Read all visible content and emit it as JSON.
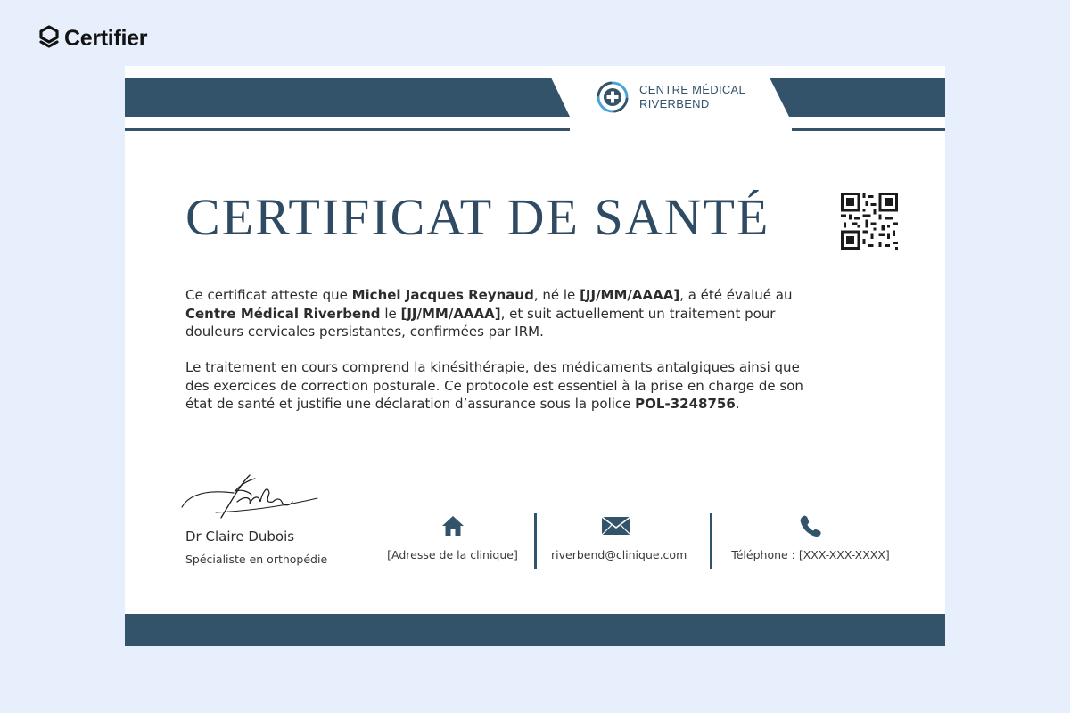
{
  "brand": {
    "name": "Certifier",
    "icon": "certifier-logo-icon"
  },
  "clinic": {
    "name_line1": "CENTRE MÉDICAL",
    "name_line2": "RIVERBEND",
    "icon": "medical-cross-icon"
  },
  "certificate": {
    "title": "CERTIFICAT DE SANTÉ",
    "paragraph1": {
      "t1": "Ce certificat atteste que ",
      "patient": "Michel Jacques Reynaud",
      "t2": ", né le ",
      "birth_date": "[JJ/MM/AAAA]",
      "t3": ", a été évalué au ",
      "clinic": "Centre Médical Riverbend",
      "t4": " le ",
      "eval_date": "[JJ/MM/AAAA]",
      "t5": ", et suit actuellement un traitement pour douleurs cervicales persistantes, confirmées par IRM."
    },
    "paragraph2": {
      "t1": "Le traitement en cours comprend la kinésithérapie, des médicaments antalgiques ainsi que des exercices de correction posturale. Ce protocole est essentiel à la prise en charge de son état de santé et justifie une déclaration d’assurance sous la police ",
      "policy": "POL-3248756",
      "t2": "."
    },
    "signer": {
      "name": "Dr Claire Dubois",
      "role": "Spécialiste en orthopédie"
    },
    "contacts": {
      "address": "[Adresse de la clinique]",
      "email": "riverbend@clinique.com",
      "phone": "Téléphone : [XXX-XXX-XXXX]"
    }
  },
  "colors": {
    "page_background": "#e6effb",
    "band": "#33536b",
    "title": "#2e4b63",
    "accent": "#4aa3d8"
  }
}
